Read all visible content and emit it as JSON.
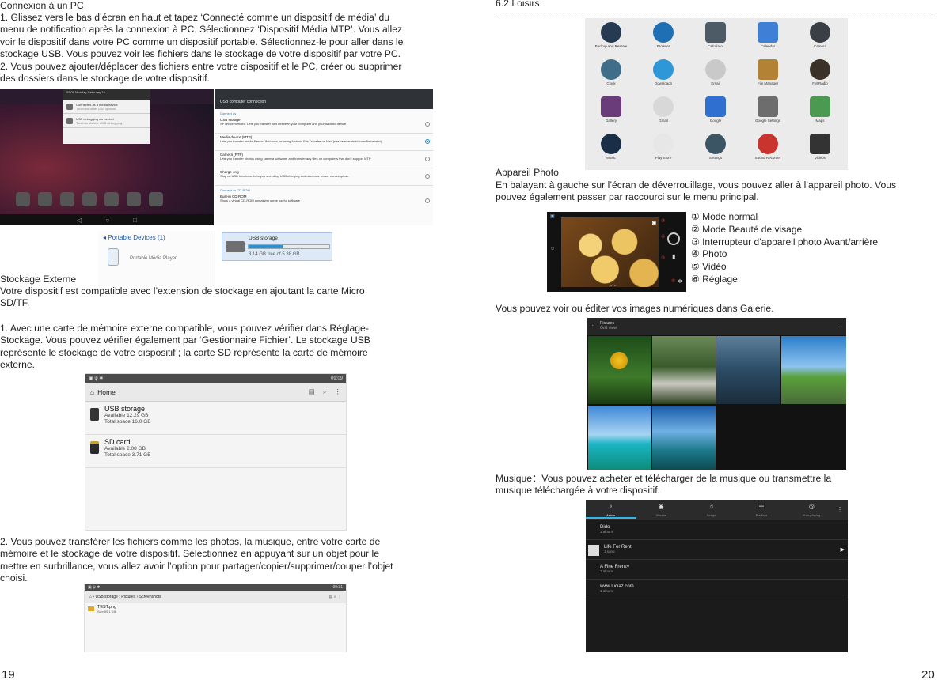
{
  "left": {
    "heading": "Connexion à un PC",
    "paragraph_lines": [
      "1. Glissez vers le bas d’écran en haut et tapez ‘Connecté comme un dispositif de média’ du",
      "menu de notification après la connexion à PC. Sélectionnez ‘Dispositif Média MTP’. Vous allez",
      "voir le dispositif dans votre PC comme un dispositif portable. Sélectionnez-le pour aller dans le",
      "stockage USB. Vous pouvez voir les fichiers dans le stockage de votre dispositif par votre PC.",
      "2. Vous pouvez ajouter/déplacer des fichiers entre votre dispositif et le PC, créer ou supprimer",
      "des dossiers dans le stockage de votre dispositif."
    ],
    "usb_screen": {
      "title": "USB computer connection",
      "section1": "Connect as",
      "options": [
        {
          "title": "USB storage",
          "desc": "SP recommended. Lets you transfer files between your computer and your Android device."
        },
        {
          "title": "Media device (MTP)",
          "desc": "Lets you transfer media files on Windows, or using Android File Transfer on Mac (see www.android.com/filetransfer)"
        },
        {
          "title": "Camera (PTP)",
          "desc": "Lets you transfer photos using camera software, and transfer any files on computers that don’t support MTP"
        },
        {
          "title": "Charge only",
          "desc": "Stop all USB functions. Lets you speed up USB charging and decrease power consumption."
        }
      ],
      "section2": "Connect as CD-ROM",
      "cdrom": {
        "title": "Built-in CD-ROM",
        "desc": "Show a virtual CD-ROM containing some useful software."
      },
      "selected_index": 1
    },
    "notification": {
      "time": "09:09",
      "date": "Monday, February 16",
      "items": [
        "Connected as a media device",
        "USB debugging connected"
      ],
      "subs": [
        "Touch for other USB options.",
        "Touch to disable USB debugging."
      ]
    },
    "portable": {
      "header": "Portable Devices (1)",
      "device_label": "Portable Media Player",
      "storage_name": "USB storage",
      "storage_free": "3.14 GB free of 5.38 GB",
      "used_fraction": 0.42
    },
    "storage_heading": "Stockage Externe",
    "storage_lines": [
      "Votre dispositif est compatible avec l’extension de stockage en ajoutant la carte Micro",
      "SD/TF."
    ],
    "storage2_lines": [
      "1. Avec une carte de mémoire externe compatible, vous pouvez vérifier dans Réglage-",
      "Stockage. Vous pouvez vérifier également par ‘Gestionnaire Fichier’. Le stockage USB",
      "représente le stockage de votre dispositif ; la carte SD représente la carte de mémoire",
      "externe."
    ],
    "fm1": {
      "time": "09:09",
      "crumb": "Home",
      "items": [
        {
          "name": "USB storage",
          "line1": "Available 12.29 GB",
          "line2": "Total space 16.0 GB"
        },
        {
          "name": "SD card",
          "line1": "Available 2.08 GB",
          "line2": "Total space 3.71 GB"
        }
      ]
    },
    "transfer_lines": [
      "2. Vous pouvez transférer les fichiers comme les photos, la musique, entre votre carte de",
      "mémoire et le stockage de votre dispositif. Sélectionnez en appuyant sur un objet pour le",
      "mettre en surbrillance, vous allez avoir l’option pour partager/copier/supprimer/couper l’objet",
      "choisi."
    ],
    "fm2": {
      "time": "09:31",
      "crumbs": [
        "USB storage",
        "Pictures",
        "Screenshots"
      ],
      "file": "TEST.png",
      "file_size": "Size 59.1 KB"
    },
    "page_number": "19"
  },
  "right": {
    "section_title": "6.2 Loisirs",
    "apps": [
      {
        "label": "Backup and Restore",
        "color": "#263a52",
        "icon": "backup-icon"
      },
      {
        "label": "Browser",
        "color": "#1f6fb5",
        "icon": "globe-icon"
      },
      {
        "label": "Calculator",
        "color": "#4d5b66",
        "icon": "calculator-icon"
      },
      {
        "label": "Calendar",
        "color": "#3f7fd6",
        "icon": "calendar-icon"
      },
      {
        "label": "Camera",
        "color": "#3a3f46",
        "icon": "camera-icon"
      },
      {
        "label": "Clock",
        "color": "#3f6d8a",
        "icon": "clock-icon"
      },
      {
        "label": "Downloads",
        "color": "#2d97d8",
        "icon": "download-icon"
      },
      {
        "label": "Email",
        "color": "#c9c9c9",
        "icon": "email-icon"
      },
      {
        "label": "File Manager",
        "color": "#b48234",
        "icon": "folder-icon"
      },
      {
        "label": "FM Radio",
        "color": "#3a3228",
        "icon": "radio-icon"
      },
      {
        "label": "Gallery",
        "color": "#6a3c7a",
        "icon": "gallery-icon"
      },
      {
        "label": "Gmail",
        "color": "#d8d8d8",
        "icon": "gmail-icon"
      },
      {
        "label": "Google",
        "color": "#2f6fd0",
        "icon": "google-icon"
      },
      {
        "label": "Google Settings",
        "color": "#6d6d6d",
        "icon": "google-settings-icon"
      },
      {
        "label": "Maps",
        "color": "#4c9a52",
        "icon": "maps-icon"
      },
      {
        "label": "Music",
        "color": "#1b2e48",
        "icon": "music-icon"
      },
      {
        "label": "Play Store",
        "color": "#e7e7e7",
        "icon": "play-store-icon"
      },
      {
        "label": "Settings",
        "color": "#3b5564",
        "icon": "settings-icon"
      },
      {
        "label": "Sound Recorder",
        "color": "#c9342f",
        "icon": "microphone-icon"
      },
      {
        "label": "Videos",
        "color": "#333333",
        "icon": "clapper-icon"
      }
    ],
    "camera_heading": "Appareil Photo",
    "camera_lines": [
      "En balayant à gauche sur l’écran de déverrouillage, vous pouvez aller à l’appareil photo. Vous",
      "pouvez également passer par raccourci sur le menu principal."
    ],
    "camera_modes": [
      "① Mode normal",
      "② Mode Beauté de visage",
      "③ Interrupteur d’appareil photo Avant/arrière",
      "④ Photo",
      "⑤ Vidéo",
      "⑥ Réglage"
    ],
    "camera_markers": [
      "①",
      "②",
      "③",
      "④",
      "⑤",
      "⑥"
    ],
    "gallery_line": "Vous pouvez voir ou éditer vos images numériques dans Galerie.",
    "gallery_screen": {
      "title": "Pictures",
      "sub": "Grid view"
    },
    "music_lines": [
      "Musique：Vous pouvez acheter et télécharger de la musique ou transmettre la",
      "musique téléchargée à votre dispositif."
    ],
    "music_screen": {
      "tabs": [
        "Artists",
        "Albums",
        "Songs",
        "Playlists",
        "Now playing"
      ],
      "rows": [
        {
          "artist": "Dido",
          "count": "1 album"
        },
        {
          "artist": "Life For Rent",
          "count": "1 song"
        },
        {
          "artist": "A Fine Frenzy",
          "count": "1 album"
        },
        {
          "artist": "www.luciaz.com",
          "count": "1 album"
        }
      ]
    },
    "page_number": "20"
  }
}
